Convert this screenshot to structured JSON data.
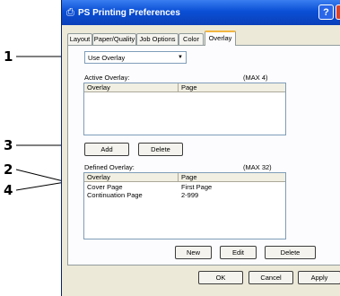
{
  "window": {
    "title": "PS  Printing Preferences",
    "help_glyph": "?",
    "close_glyph": "X"
  },
  "tabs": [
    "Layout",
    "Paper/Quality",
    "Job Options",
    "Color",
    "Overlay"
  ],
  "overlay_select": {
    "value": "Use Overlay"
  },
  "active_overlay": {
    "label": "Active Overlay:",
    "max": "(MAX 4)",
    "columns": [
      "Overlay",
      "Page"
    ],
    "rows": []
  },
  "active_buttons": {
    "add": "Add",
    "delete": "Delete"
  },
  "defined_overlay": {
    "label": "Defined Overlay:",
    "max": "(MAX 32)",
    "columns": [
      "Overlay",
      "Page"
    ],
    "rows": [
      {
        "overlay": "Cover Page",
        "page": "First Page"
      },
      {
        "overlay": "Continuation Page",
        "page": "2-999"
      }
    ]
  },
  "defined_buttons": {
    "new": "New",
    "edit": "Edit",
    "delete": "Delete"
  },
  "dialog_buttons": {
    "ok": "OK",
    "cancel": "Cancel",
    "apply": "Apply"
  },
  "callouts": [
    "1",
    "2",
    "3",
    "4"
  ]
}
